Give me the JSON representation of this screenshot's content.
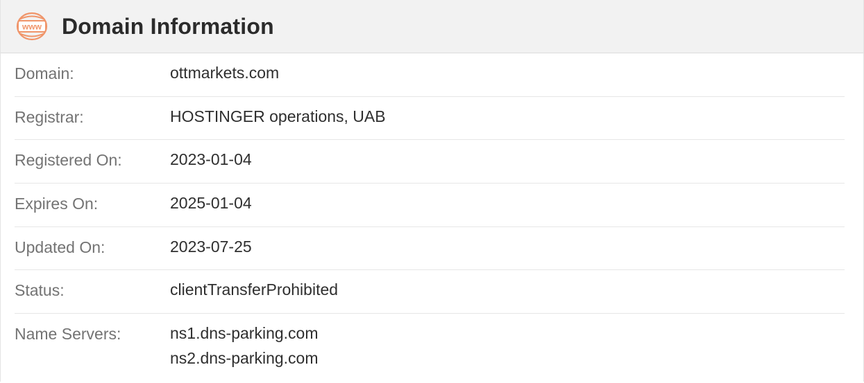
{
  "header": {
    "title": "Domain Information",
    "icon": "www-icon",
    "icon_color": "#f0956a"
  },
  "rows": [
    {
      "label": "Domain:",
      "value": "ottmarkets.com"
    },
    {
      "label": "Registrar:",
      "value": "HOSTINGER operations, UAB"
    },
    {
      "label": "Registered On:",
      "value": "2023-01-04"
    },
    {
      "label": "Expires On:",
      "value": "2025-01-04"
    },
    {
      "label": "Updated On:",
      "value": "2023-07-25"
    },
    {
      "label": "Status:",
      "value": "clientTransferProhibited"
    },
    {
      "label": "Name Servers:",
      "values": [
        "ns1.dns-parking.com",
        "ns2.dns-parking.com"
      ]
    }
  ]
}
